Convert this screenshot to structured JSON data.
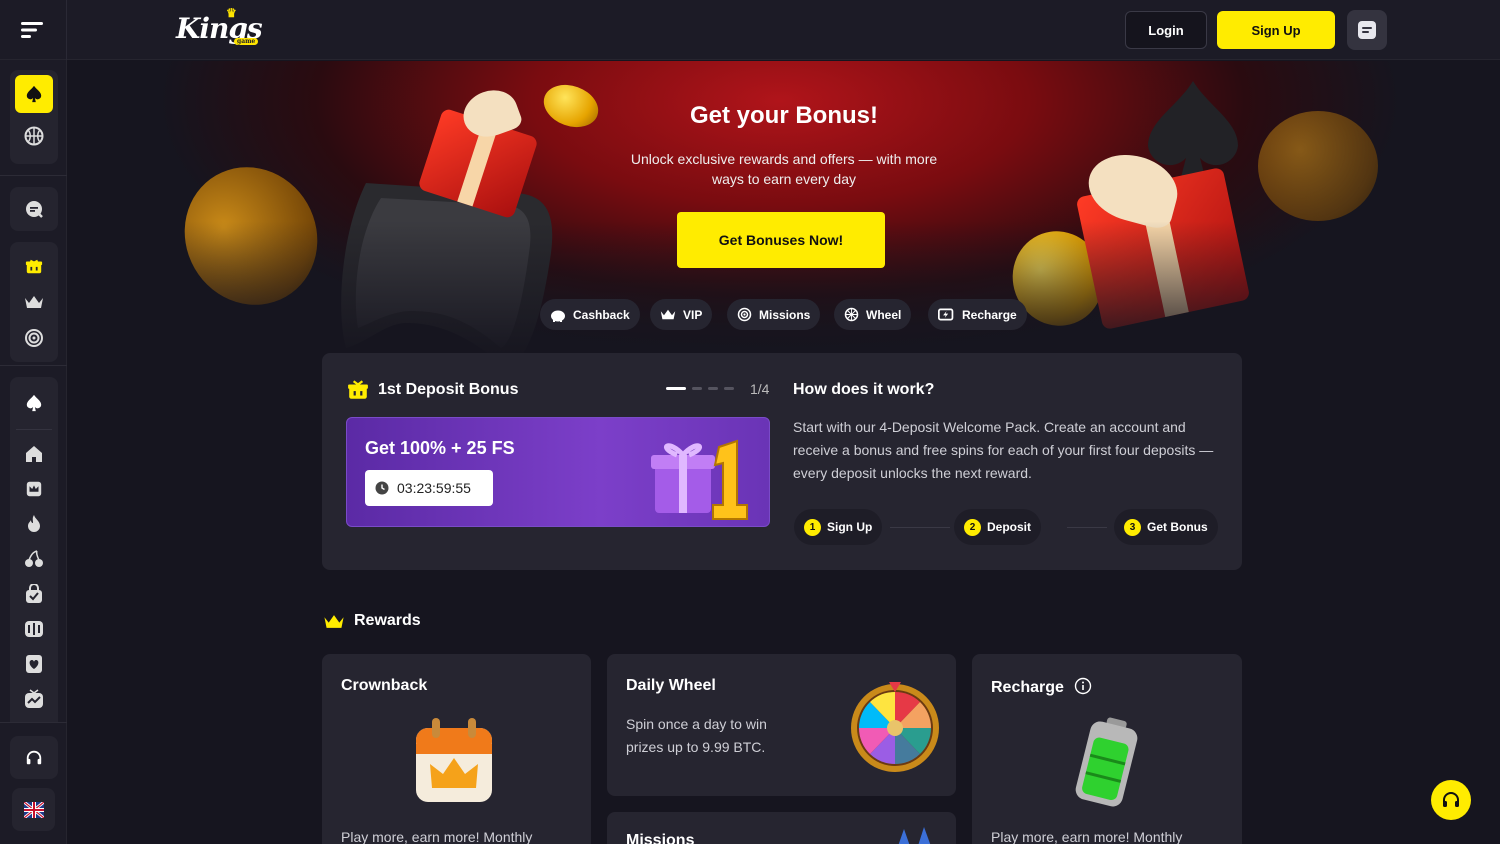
{
  "header": {
    "logo_text": "Kings",
    "logo_sub": "game",
    "login_label": "Login",
    "signup_label": "Sign Up"
  },
  "sidebar": {
    "items": [
      "spade-icon",
      "basketball-icon",
      "chat-icon",
      "gift-icon",
      "crown-icon",
      "target-icon",
      "spade-icon",
      "home-icon",
      "crown-box-icon",
      "fire-icon",
      "cherry-icon",
      "bag-icon",
      "slots-icon",
      "heart-card-icon",
      "live-tv-icon",
      "headset-icon",
      "uk-flag-icon"
    ],
    "accent": "#ffec00"
  },
  "hero": {
    "title": "Get your Bonus!",
    "text": "Unlock exclusive rewards and offers — with more ways to earn every day",
    "button": "Get Bonuses Now!",
    "chips": [
      "Cashback",
      "VIP",
      "Missions",
      "Wheel",
      "Recharge"
    ]
  },
  "deposit": {
    "title": "1st Deposit Bonus",
    "page": "1/4",
    "offer_title": "Get 100% + 25 FS",
    "timer": "03:23:59:55",
    "how_title": "How does it work?",
    "how_text": "Start with our 4-Deposit Welcome Pack. Create an account and receive a bonus and free spins for each of your first four deposits — every deposit unlocks the next reward.",
    "steps": [
      {
        "num": "1",
        "label": "Sign Up"
      },
      {
        "num": "2",
        "label": "Deposit"
      },
      {
        "num": "3",
        "label": "Get Bonus"
      }
    ]
  },
  "rewards": {
    "heading": "Rewards",
    "crownback": {
      "title": "Crownback",
      "text": "Play more, earn more! Monthly"
    },
    "wheel": {
      "title": "Daily Wheel",
      "text": "Spin once a day to win prizes up to 9.99 BTC."
    },
    "missions": {
      "title": "Missions"
    },
    "recharge": {
      "title": "Recharge",
      "text": "Play more, earn more! Monthly"
    }
  }
}
